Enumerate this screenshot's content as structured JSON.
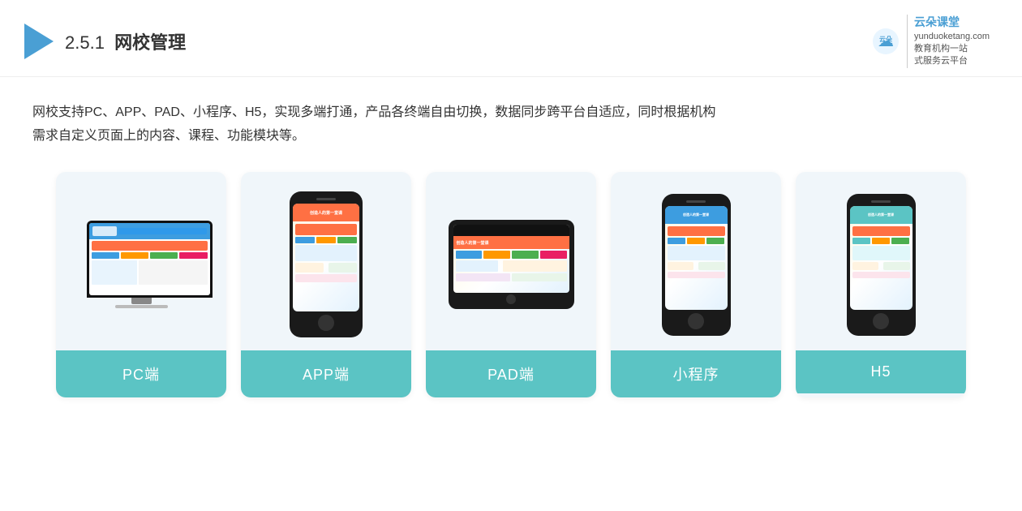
{
  "header": {
    "section_number": "2.5.1",
    "title_bold": "网校管理",
    "logo_alt": "云朵课堂",
    "brand_url": "yunduoketang.com",
    "brand_tagline1": "教育机构一站",
    "brand_tagline2": "式服务云平台"
  },
  "description": {
    "text_line1": "网校支持PC、APP、PAD、小程序、H5，实现多端打通，产品各终端自由切换，数据同步跨平台自适应，同时根据机构",
    "text_line2": "需求自定义页面上的内容、课程、功能模块等。"
  },
  "cards": [
    {
      "id": "pc",
      "label": "PC端",
      "device": "pc"
    },
    {
      "id": "app",
      "label": "APP端",
      "device": "phone"
    },
    {
      "id": "pad",
      "label": "PAD端",
      "device": "tablet"
    },
    {
      "id": "mini",
      "label": "小程序",
      "device": "phone"
    },
    {
      "id": "h5",
      "label": "H5",
      "device": "phone"
    }
  ]
}
